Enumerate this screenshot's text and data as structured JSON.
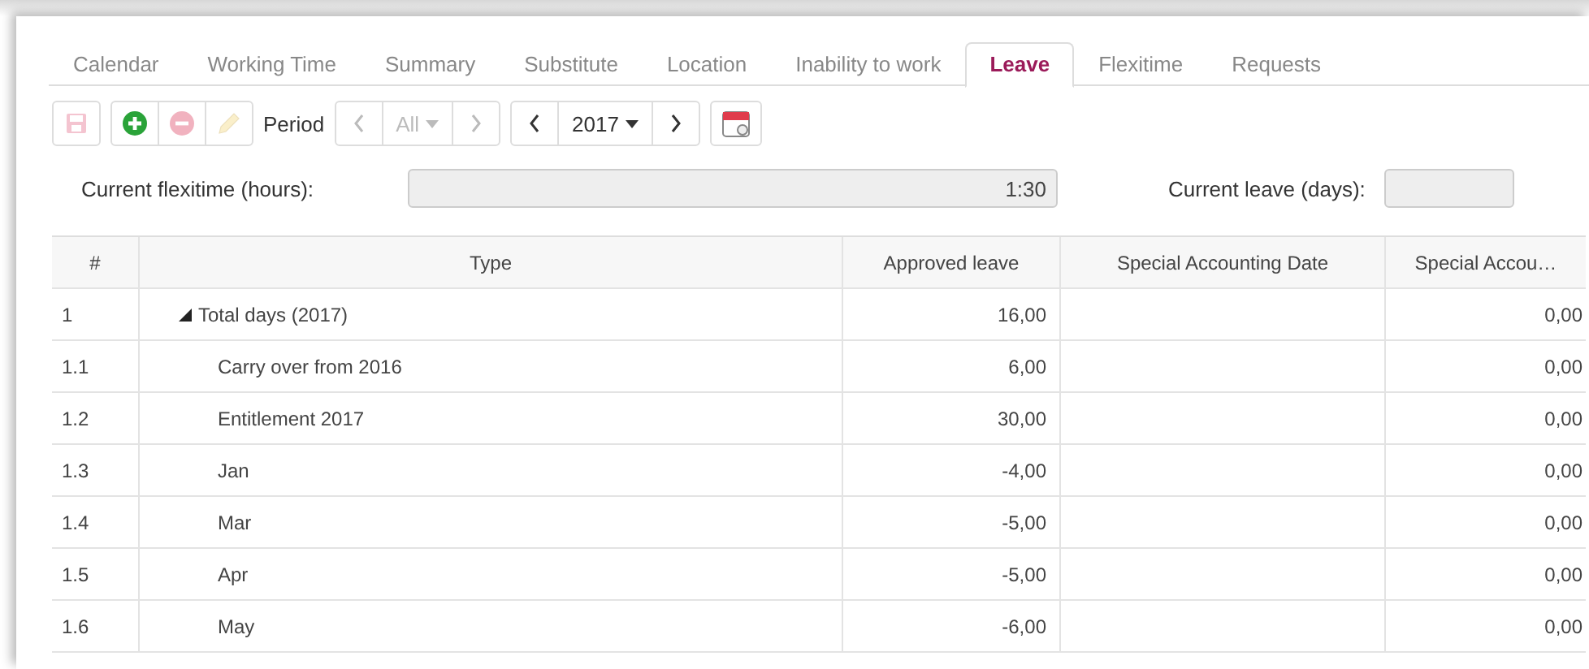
{
  "tabs": [
    {
      "label": "Calendar",
      "selected": false
    },
    {
      "label": "Working Time",
      "selected": false
    },
    {
      "label": "Summary",
      "selected": false
    },
    {
      "label": "Substitute",
      "selected": false
    },
    {
      "label": "Location",
      "selected": false
    },
    {
      "label": "Inability to work",
      "selected": false
    },
    {
      "label": "Leave",
      "selected": true
    },
    {
      "label": "Flexitime",
      "selected": false
    },
    {
      "label": "Requests",
      "selected": false
    }
  ],
  "toolbar": {
    "save": {
      "disabled": true
    },
    "add": {
      "disabled": false
    },
    "remove": {
      "disabled": true
    },
    "edit": {
      "disabled": true
    },
    "period_label": "Period",
    "period": {
      "value": "All",
      "disabled": true
    },
    "year": {
      "value": "2017",
      "disabled": false
    }
  },
  "fields": [
    {
      "label": "Current flexitime (hours):",
      "value": "1:30"
    },
    {
      "label": "Current leave (days):"
    }
  ],
  "table": {
    "columns": [
      "#",
      "Type",
      "Approved leave",
      "Special Accounting Date",
      "Special Accou…"
    ],
    "rows": [
      {
        "num": "1",
        "type": "Total days (2017)",
        "approved": "16,00",
        "special": "0,00",
        "expanded": true,
        "children": [
          {
            "num": "1.1",
            "type": "Carry over from 2016",
            "approved": "6,00",
            "special": "0,00"
          },
          {
            "num": "1.2",
            "type": "Entitlement 2017",
            "approved": "30,00",
            "special": "0,00"
          },
          {
            "num": "1.3",
            "type": "Jan",
            "approved": "-4,00",
            "special": "0,00"
          },
          {
            "num": "1.4",
            "type": "Mar",
            "approved": "-5,00",
            "special": "0,00"
          },
          {
            "num": "1.5",
            "type": "Apr",
            "approved": "-5,00",
            "special": "0,00"
          },
          {
            "num": "1.6",
            "type": "May",
            "approved": "-6,00",
            "special": "0,00"
          }
        ]
      }
    ]
  }
}
